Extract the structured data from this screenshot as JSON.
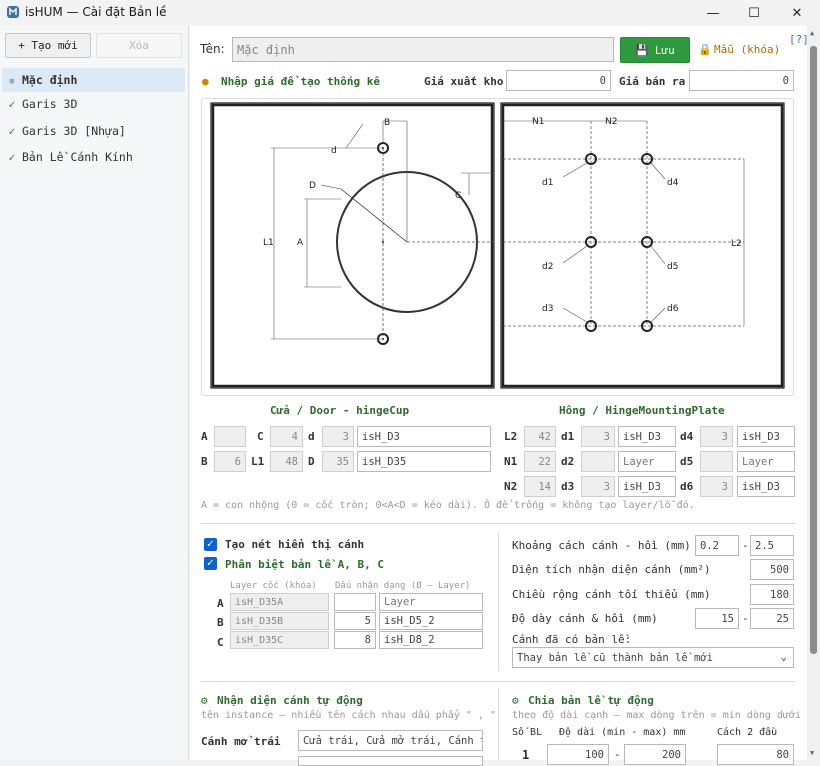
{
  "window": {
    "title": "isHUM — Cài đặt Bản lề"
  },
  "sidebar": {
    "add_label": "+ Tạo mới",
    "delete_label": "Xóa",
    "items": [
      {
        "label": "Mặc định",
        "mark": "▪"
      },
      {
        "label": "Garis 3D",
        "mark": "✓"
      },
      {
        "label": "Garis 3D [Nhựa]",
        "mark": "✓"
      },
      {
        "label": "Bản Lề Cánh Kính",
        "mark": "✓"
      }
    ]
  },
  "header": {
    "name_label": "Tên:",
    "name_value": "Mặc định",
    "save_label": "Lưu",
    "lock_label": "Mẫu (khóa)",
    "help": "[?]"
  },
  "price": {
    "hint": "Nhập giá để tạo thống kê",
    "cost_label": "Giá xuất kho",
    "cost_value": "0",
    "sale_label": "Giá bán ra",
    "sale_value": "0"
  },
  "diagram": {
    "left": {
      "labels": [
        "d",
        "B",
        "D",
        "C",
        "L1",
        "A"
      ]
    },
    "right": {
      "labels": [
        "N1",
        "N2",
        "d1",
        "d4",
        "d2",
        "d5",
        "d3",
        "d6",
        "L2"
      ]
    }
  },
  "door": {
    "title": "Cửa / Door - hingeCup",
    "A_label": "A",
    "A_value": "",
    "C_label": "C",
    "C_value": "4",
    "d_label": "d",
    "d_value": "3",
    "d_layer": "isH_D3",
    "B_label": "B",
    "B_value": "6",
    "L1_label": "L1",
    "L1_value": "48",
    "D_label": "D",
    "D_value": "35",
    "D_layer": "isH_D35"
  },
  "plate": {
    "title": "Hông / HingeMountingPlate",
    "L2_label": "L2",
    "L2_value": "42",
    "N1_label": "N1",
    "N1_value": "22",
    "N2_label": "N2",
    "N2_value": "14",
    "d1_label": "d1",
    "d1_value": "3",
    "d1_layer": "isH_D3",
    "d2_label": "d2",
    "d2_value": "",
    "d2_layer": "Layer",
    "d3_label": "d3",
    "d3_value": "3",
    "d3_layer": "isH_D3",
    "d4_label": "d4",
    "d4_value": "3",
    "d4_layer": "isH_D3",
    "d5_label": "d5",
    "d5_value": "",
    "d5_layer": "Layer",
    "d6_label": "d6",
    "d6_value": "3",
    "d6_layer": "isH_D3"
  },
  "note": "A = con nhộng (0 = cốc tròn; 0<A<D = kéo dài). Ô để trống = không tạo layer/lỗ đó.",
  "options": {
    "show_edges": "Tạo nét hiển thị cánh",
    "distinguish": "Phân biệt bản lề A, B, C",
    "col_layer": "Layer cốc (khóa)",
    "col_mark": "Dấu nhận dạng (Ø — Layer)",
    "rows": [
      {
        "key": "A",
        "layer": "isH_D35A",
        "mark": "",
        "mark_layer": "Layer"
      },
      {
        "key": "B",
        "layer": "isH_D35B",
        "mark": "5",
        "mark_layer": "isH_D5_2"
      },
      {
        "key": "C",
        "layer": "isH_D35C",
        "mark": "8",
        "mark_layer": "isH_D8_2"
      }
    ]
  },
  "params": {
    "gap_label": "Khoảng cách cánh - hồi (mm)",
    "gap_min": "0.2",
    "gap_max": "2.5",
    "area_label": "Diện tích nhận diện cánh (mm²)",
    "area_value": "500",
    "width_label": "Chiều rộng cánh tối thiểu (mm)",
    "width_value": "180",
    "thick_label": "Độ dày cánh & hồi (mm)",
    "thick_min": "15",
    "thick_max": "25",
    "existing_label": "Cánh đã có bản lề:",
    "existing_value": "Thay bản lề cũ thành bản lề mới"
  },
  "auto_detect": {
    "title": "Nhận diện cánh tự động",
    "hint": "tên instance — nhiều tên cách nhau dấu phẩy \" , \"",
    "left_door_label": "Cánh mở trái",
    "left_door_value": "Cửa trái, Cửa mở trái, Cánh t"
  },
  "auto_split": {
    "title": "Chia bản lề tự động",
    "hint": "theo độ dài cạnh — max dòng trên = min dòng dưới",
    "col_count": "Số BL",
    "col_length": "Độ dài (min - max) mm",
    "col_offset": "Cách 2 đầu",
    "row_count": "1",
    "row_min": "100",
    "row_max": "200",
    "row_offset": "80"
  },
  "colors": {
    "accent": "#2e7d32",
    "selection": "#dce9f7",
    "check": "#0a64d0"
  }
}
